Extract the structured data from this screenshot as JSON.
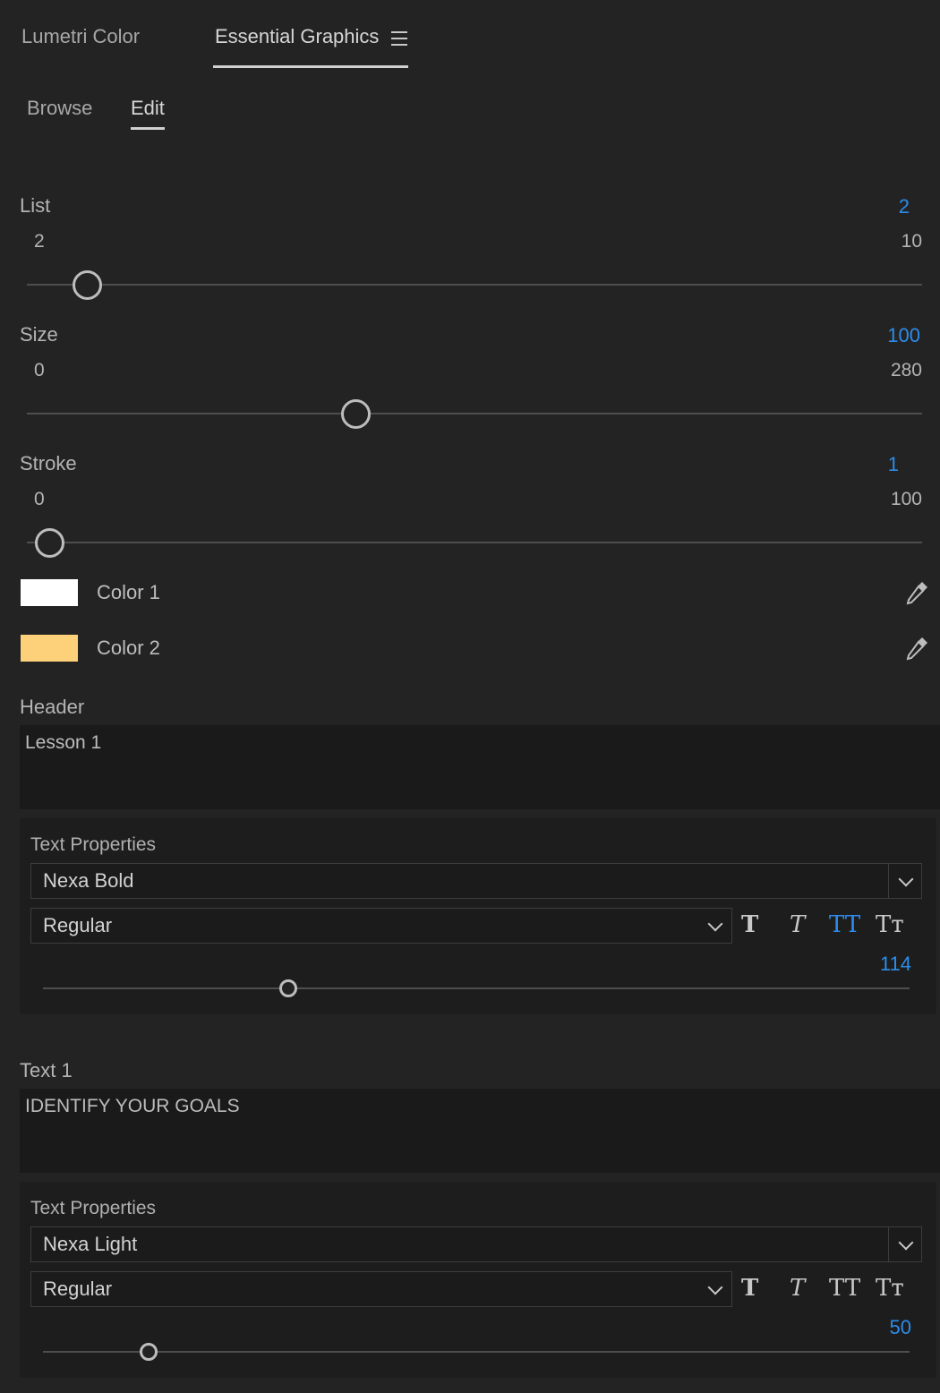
{
  "panel_tabs": [
    {
      "label": "Lumetri Color",
      "active": false
    },
    {
      "label": "Essential Graphics",
      "active": true
    }
  ],
  "panel_menu_icon": "hamburger-menu-icon",
  "sub_tabs": [
    {
      "label": "Browse",
      "active": false
    },
    {
      "label": "Edit",
      "active": true
    }
  ],
  "controls": {
    "list": {
      "label": "List",
      "value": "2",
      "min": "2",
      "max": "10"
    },
    "size": {
      "label": "Size",
      "value": "100",
      "min": "0",
      "max": "280"
    },
    "stroke": {
      "label": "Stroke",
      "value": "1",
      "min": "0",
      "max": "100"
    }
  },
  "colors": [
    {
      "label": "Color 1",
      "swatch": "#ffffff",
      "icon": "eyedropper-icon"
    },
    {
      "label": "Color 2",
      "swatch": "#fdd07a",
      "icon": "eyedropper-icon"
    }
  ],
  "header": {
    "label": "Header",
    "text": "Lesson 1",
    "props": {
      "title": "Text Properties",
      "font": "Nexa Bold",
      "style": "Regular",
      "size_value": "114",
      "buttons": [
        {
          "glyph": "T",
          "name": "faux-bold",
          "active": false
        },
        {
          "glyph": "T",
          "name": "faux-italic",
          "active": false
        },
        {
          "glyph": "TT",
          "name": "all-caps",
          "active": true
        },
        {
          "glyph": "Tᴛ",
          "name": "small-caps",
          "active": false
        }
      ]
    }
  },
  "text1": {
    "label": "Text 1",
    "text": "IDENTIFY YOUR GOALS",
    "props": {
      "title": "Text Properties",
      "font": "Nexa Light",
      "style": "Regular",
      "size_value": "50",
      "buttons": [
        {
          "glyph": "T",
          "name": "faux-bold",
          "active": false
        },
        {
          "glyph": "T",
          "name": "faux-italic",
          "active": false
        },
        {
          "glyph": "TT",
          "name": "all-caps",
          "active": false
        },
        {
          "glyph": "Tᴛ",
          "name": "small-caps",
          "active": false
        }
      ]
    }
  },
  "accent_color": "#2d8ceb"
}
